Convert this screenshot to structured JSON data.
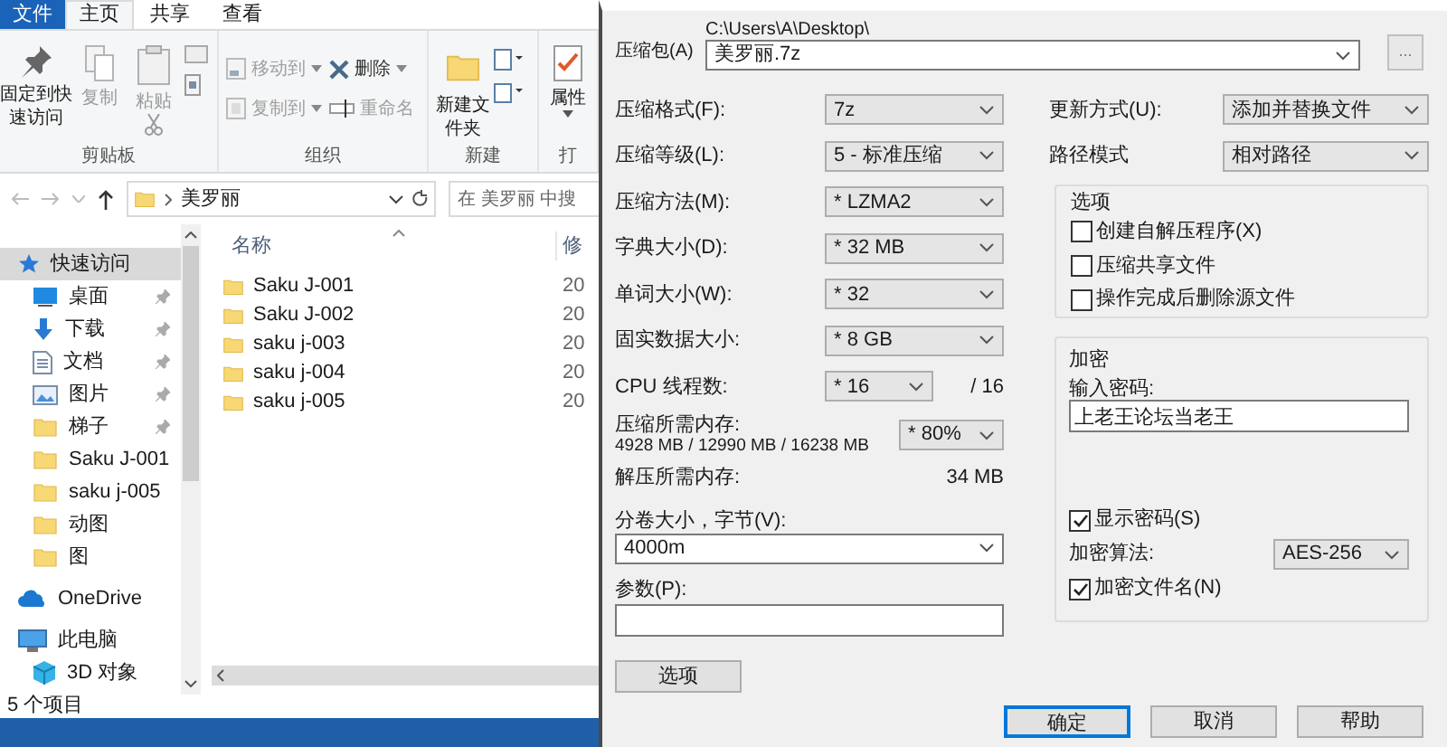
{
  "explorer": {
    "ribbon_tabs": [
      {
        "label": "文件",
        "kind": "file",
        "selected": false
      },
      {
        "label": "主页",
        "kind": "tab",
        "selected": true
      },
      {
        "label": "共享",
        "kind": "tab",
        "selected": false
      },
      {
        "label": "查看",
        "kind": "tab",
        "selected": false
      }
    ],
    "ribbon_groups": [
      {
        "label": "剪贴板",
        "kind": "clipboard",
        "items": [
          {
            "label": "固定到快速访问",
            "kind": "pin",
            "disabled": false
          },
          {
            "label": "复制",
            "kind": "copy",
            "disabled": true
          },
          {
            "label": "粘贴",
            "kind": "paste",
            "disabled": true
          }
        ]
      },
      {
        "label": "组织",
        "kind": "organize",
        "items": [
          {
            "label": "移动到",
            "kind": "move",
            "disabled": true
          },
          {
            "label": "复制到",
            "kind": "copyto",
            "disabled": true
          },
          {
            "label": "删除",
            "kind": "delete",
            "disabled": false
          },
          {
            "label": "重命名",
            "kind": "rename",
            "disabled": true
          }
        ]
      },
      {
        "label": "新建",
        "kind": "new",
        "items": [
          {
            "label": "新建文件夹",
            "kind": "folder",
            "disabled": false
          }
        ]
      },
      {
        "label": "打",
        "kind": "open",
        "items": [
          {
            "label": "属性",
            "kind": "properties",
            "disabled": false
          }
        ]
      }
    ],
    "address": {
      "path": "美罗丽",
      "search_placeholder": "在 美罗丽 中搜"
    },
    "nav": [
      {
        "label": "快速访问",
        "kind": "star",
        "selected": true,
        "children": [
          {
            "label": "桌面",
            "kind": "desktop",
            "pinned": true
          },
          {
            "label": "下载",
            "kind": "download",
            "pinned": true
          },
          {
            "label": "文档",
            "kind": "document",
            "pinned": true
          },
          {
            "label": "图片",
            "kind": "picture",
            "pinned": true
          },
          {
            "label": "梯子",
            "kind": "folder",
            "pinned": true
          },
          {
            "label": "Saku J-001",
            "kind": "folder",
            "pinned": false
          },
          {
            "label": "saku j-005",
            "kind": "folder",
            "pinned": false
          },
          {
            "label": "动图",
            "kind": "folder",
            "pinned": false
          },
          {
            "label": "图",
            "kind": "folder",
            "pinned": false
          }
        ]
      },
      {
        "label": "OneDrive",
        "kind": "cloud",
        "selected": false
      },
      {
        "label": "此电脑",
        "kind": "pc",
        "selected": false,
        "children": [
          {
            "label": "3D 对象",
            "kind": "cube",
            "pinned": false
          }
        ]
      }
    ],
    "columns": [
      "名称",
      "修"
    ],
    "files": [
      {
        "name": "Saku J-001",
        "column_2": "20"
      },
      {
        "name": "Saku J-002",
        "column_2": "20"
      },
      {
        "name": "saku j-003",
        "column_2": "20"
      },
      {
        "name": "saku j-004",
        "column_2": "20"
      },
      {
        "name": "saku j-005",
        "column_2": "20"
      }
    ],
    "status_bar": "5 个项目"
  },
  "dialog": {
    "archive": {
      "label": "压缩包(A)",
      "path": "C:\\Users\\A\\Desktop\\",
      "value": "美罗丽.7z"
    },
    "browse_button": "...",
    "left_fields": [
      {
        "label": "压缩格式(F):",
        "value": "7z"
      },
      {
        "label": "压缩等级(L):",
        "value": "5 - 标准压缩"
      },
      {
        "label": "压缩方法(M):",
        "value": "* LZMA2"
      },
      {
        "label": "字典大小(D):",
        "value": "* 32 MB"
      },
      {
        "label": "单词大小(W):",
        "value": "* 32"
      },
      {
        "label": "固实数据大小:",
        "value": "* 8 GB"
      }
    ],
    "cpu": {
      "label": "CPU 线程数:",
      "value": "* 16",
      "max": "/ 16"
    },
    "memory": {
      "label": "压缩所需内存:",
      "detail": "4928 MB / 12990 MB / 16238 MB",
      "value": "* 80%"
    },
    "decompress_memory": {
      "label": "解压所需内存:",
      "value": "34 MB"
    },
    "volume": {
      "label": "分卷大小，字节(V):",
      "value": "4000m"
    },
    "parameters": {
      "label": "参数(P):"
    },
    "options_button": "选项",
    "update_mode": {
      "label": "更新方式(U):",
      "value": "添加并替换文件"
    },
    "path_mode": {
      "label": "路径模式",
      "value": "相对路径"
    },
    "options_group": {
      "title": "选项",
      "checkboxes": [
        {
          "label": "创建自解压程序(X)",
          "checked": false
        },
        {
          "label": "压缩共享文件",
          "checked": false
        },
        {
          "label": "操作完成后删除源文件",
          "checked": false
        }
      ]
    },
    "encryption": {
      "title": "加密",
      "password_label": "输入密码:",
      "password": "上老王论坛当老王",
      "show_password": {
        "label": "显示密码(S)",
        "checked": true
      },
      "method": {
        "label": "加密算法:",
        "value": "AES-256"
      },
      "encrypt_names": {
        "label": "加密文件名(N)",
        "checked": true
      }
    },
    "buttons": [
      {
        "label": "确定",
        "default": true
      },
      {
        "label": "取消",
        "default": false
      },
      {
        "label": "帮助",
        "default": false
      }
    ]
  }
}
